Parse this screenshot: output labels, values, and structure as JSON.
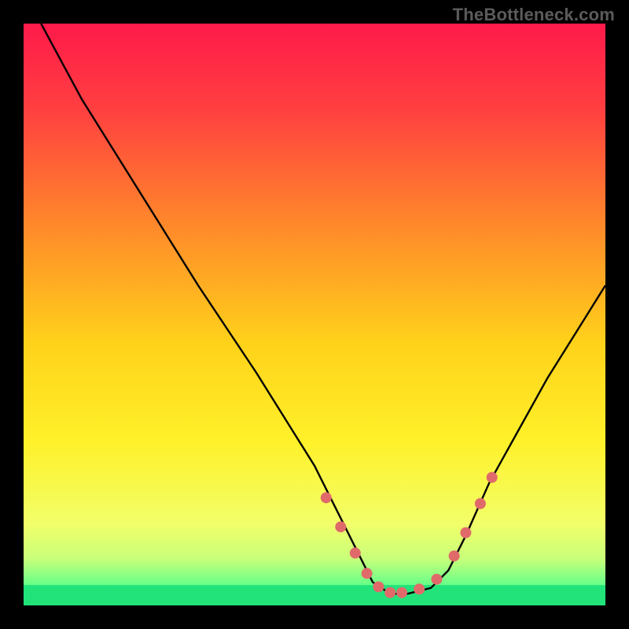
{
  "watermark": "TheBottleneck.com",
  "chart_data": {
    "type": "line",
    "title": "",
    "xlabel": "",
    "ylabel": "",
    "x_range": [
      0,
      100
    ],
    "y_range": [
      0,
      100
    ],
    "grid": false,
    "legend": false,
    "background_gradient_stops": [
      {
        "offset": 0.0,
        "color": "#ff1a4b"
      },
      {
        "offset": 0.15,
        "color": "#ff4040"
      },
      {
        "offset": 0.35,
        "color": "#ff8a2a"
      },
      {
        "offset": 0.55,
        "color": "#ffd21a"
      },
      {
        "offset": 0.72,
        "color": "#fff12a"
      },
      {
        "offset": 0.86,
        "color": "#f2ff6a"
      },
      {
        "offset": 0.92,
        "color": "#c8ff7a"
      },
      {
        "offset": 0.97,
        "color": "#5bff8a"
      },
      {
        "offset": 1.0,
        "color": "#1fd87a"
      }
    ],
    "series": [
      {
        "name": "bottleneck-curve",
        "color": "#000000",
        "x": [
          3,
          10,
          20,
          30,
          40,
          50,
          55,
          58,
          60,
          63,
          66,
          70,
          73,
          76,
          80,
          85,
          90,
          95,
          100
        ],
        "y": [
          100,
          87,
          71,
          55,
          40,
          24,
          14,
          8,
          4,
          2,
          2,
          3,
          6,
          12,
          21,
          30,
          39,
          47,
          55
        ]
      }
    ],
    "marker_points": {
      "name": "highlight-markers",
      "color": "#e06a6a",
      "radius": 7,
      "x": [
        52,
        54.5,
        57,
        59,
        61,
        63,
        65,
        68,
        71,
        74,
        76,
        78.5,
        80.5
      ],
      "y": [
        18.5,
        13.5,
        9,
        5.5,
        3.2,
        2.2,
        2.2,
        2.8,
        4.5,
        8.5,
        12.5,
        17.5,
        22
      ]
    },
    "green_band": {
      "y_from": 0,
      "y_to": 3.5
    }
  }
}
